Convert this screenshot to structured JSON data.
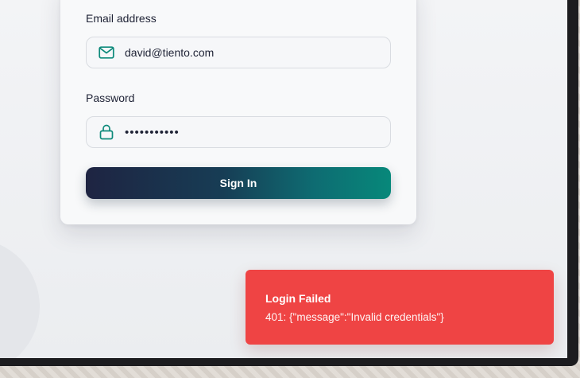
{
  "form": {
    "email_label": "Email address",
    "email_value": "david@tiento.com",
    "password_label": "Password",
    "password_value": "•••••••••••",
    "submit_label": "Sign In",
    "email_icon": "mail-icon",
    "password_icon": "lock-icon"
  },
  "toast": {
    "title": "Login Failed",
    "message": "401: {\"message\":\"Invalid credentials\"}"
  },
  "colors": {
    "accent": "#0e8a7b",
    "button_gradient_start": "#1e2442",
    "button_gradient_end": "#07887a",
    "toast_bg": "#ef4444"
  }
}
